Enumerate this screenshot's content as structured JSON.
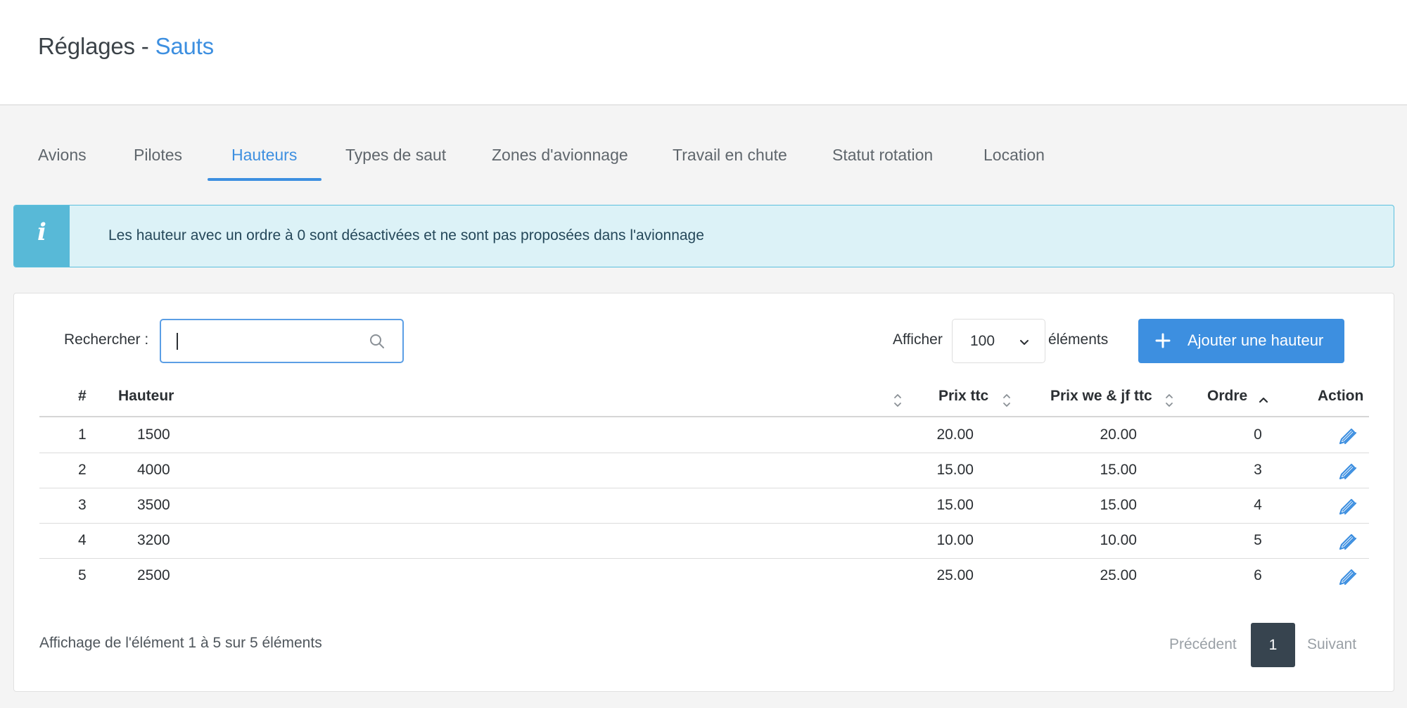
{
  "header": {
    "title_prefix": "Réglages -",
    "title_accent": "Sauts"
  },
  "tabs": [
    {
      "label": "Avions"
    },
    {
      "label": "Pilotes"
    },
    {
      "label": "Hauteurs",
      "active": true
    },
    {
      "label": "Types de saut"
    },
    {
      "label": "Zones d'avionnage"
    },
    {
      "label": "Travail en chute"
    },
    {
      "label": "Statut rotation"
    },
    {
      "label": "Location"
    }
  ],
  "alert": {
    "icon": "info-icon",
    "text": "Les hauteur avec un ordre à 0 sont désactivées et ne sont pas proposées dans l'avionnage"
  },
  "toolbar": {
    "search_label": "Rechercher :",
    "search_value": "",
    "show_label": "Afficher",
    "page_size": "100",
    "elements_label": "éléments",
    "add_button_label": "Ajouter une hauteur"
  },
  "table": {
    "columns": [
      "#",
      "Hauteur",
      "Prix ttc",
      "Prix we & jf ttc",
      "Ordre",
      "Action"
    ],
    "rows": [
      {
        "num": "1",
        "hauteur": "1500",
        "prix": "20.00",
        "prix_we": "20.00",
        "ordre": "0"
      },
      {
        "num": "2",
        "hauteur": "4000",
        "prix": "15.00",
        "prix_we": "15.00",
        "ordre": "3"
      },
      {
        "num": "3",
        "hauteur": "3500",
        "prix": "15.00",
        "prix_we": "15.00",
        "ordre": "4"
      },
      {
        "num": "4",
        "hauteur": "3200",
        "prix": "10.00",
        "prix_we": "10.00",
        "ordre": "5"
      },
      {
        "num": "5",
        "hauteur": "2500",
        "prix": "25.00",
        "prix_we": "25.00",
        "ordre": "6"
      }
    ],
    "sorted_column": "Ordre",
    "sort_direction": "ascending"
  },
  "footer": {
    "info": "Affichage de l'élément 1 à 5 sur 5 éléments",
    "previous_label": "Précédent",
    "current_page": "1",
    "next_label": "Suivant"
  },
  "colors": {
    "accent": "#3d8fe0",
    "alert_bg": "#dcf2f7",
    "alert_icon_bg": "#58b9d7",
    "page_active": "#37444f"
  }
}
